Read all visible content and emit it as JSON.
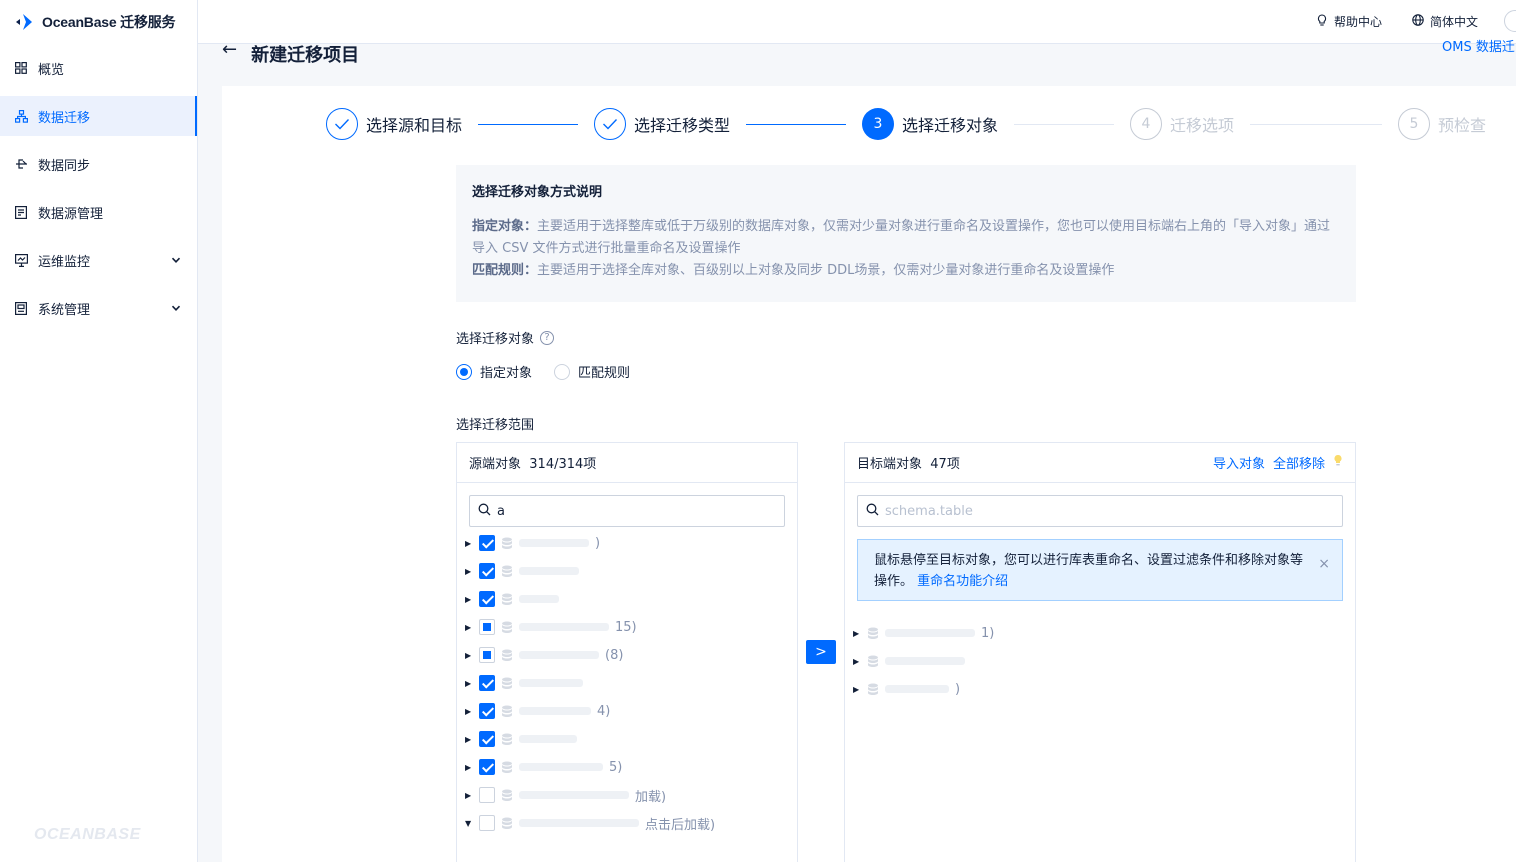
{
  "app": {
    "title": "OceanBase 迁移服务",
    "footer_logo": "OCEANBASE"
  },
  "sidebar": {
    "items": [
      {
        "label": "概览",
        "icon": "grid-icon"
      },
      {
        "label": "数据迁移",
        "icon": "migration-icon",
        "active": true
      },
      {
        "label": "数据同步",
        "icon": "sync-icon"
      },
      {
        "label": "数据源管理",
        "icon": "datasource-icon"
      },
      {
        "label": "运维监控",
        "icon": "monitor-icon",
        "expandable": true
      },
      {
        "label": "系统管理",
        "icon": "system-icon",
        "expandable": true
      }
    ]
  },
  "header": {
    "help": "帮助中心",
    "language": "简体中文",
    "corner_link": "OMS 数据迁"
  },
  "page": {
    "title": "新建迁移项目"
  },
  "steps": [
    {
      "index": "1",
      "label": "选择源和目标",
      "state": "done"
    },
    {
      "index": "2",
      "label": "选择迁移类型",
      "state": "done"
    },
    {
      "index": "3",
      "label": "选择迁移对象",
      "state": "current"
    },
    {
      "index": "4",
      "label": "迁移选项",
      "state": "todo"
    },
    {
      "index": "5",
      "label": "预检查",
      "state": "todo"
    }
  ],
  "info": {
    "title": "选择迁移对象方式说明",
    "line1_key": "指定对象：",
    "line1_text": "主要适用于选择整库或低于万级别的数据库对象，仅需对少量对象进行重命名及设置操作，您也可以使用目标端右上角的「导入对象」通过导入 CSV 文件方式进行批量重命名及设置操作",
    "line2_key": "匹配规则：",
    "line2_text": "主要适用于选择全库对象、百级别以上对象及同步 DDL场景，仅需对少量对象进行重命名及设置操作"
  },
  "select_object": {
    "label": "选择迁移对象",
    "options": [
      "指定对象",
      "匹配规则"
    ],
    "selected": "指定对象"
  },
  "range": {
    "label": "选择迁移范围"
  },
  "source": {
    "title": "源端对象",
    "count": "314/314项",
    "search_value": "a",
    "rows": [
      {
        "state": "checked",
        "suffix": ")"
      },
      {
        "state": "checked",
        "suffix": ""
      },
      {
        "state": "checked",
        "suffix": ""
      },
      {
        "state": "partial",
        "suffix": "15)"
      },
      {
        "state": "partial",
        "suffix": "(8)"
      },
      {
        "state": "checked",
        "suffix": ""
      },
      {
        "state": "checked",
        "suffix": "4)"
      },
      {
        "state": "checked",
        "suffix": ""
      },
      {
        "state": "checked",
        "suffix": "5)"
      },
      {
        "state": "none",
        "suffix": "加载)"
      },
      {
        "state": "none",
        "suffix": "点击后加载)"
      }
    ]
  },
  "target": {
    "title": "目标端对象",
    "count": "47项",
    "import_label": "导入对象",
    "remove_all_label": "全部移除",
    "search_placeholder": "schema.table",
    "alert_text": "鼠标悬停至目标对象，您可以进行库表重命名、设置过滤条件和移除对象等操作。",
    "alert_link": "重命名功能介绍",
    "rows": [
      {
        "suffix": "1)"
      },
      {
        "suffix": ""
      },
      {
        "suffix": ")"
      }
    ]
  },
  "move_button": ">"
}
